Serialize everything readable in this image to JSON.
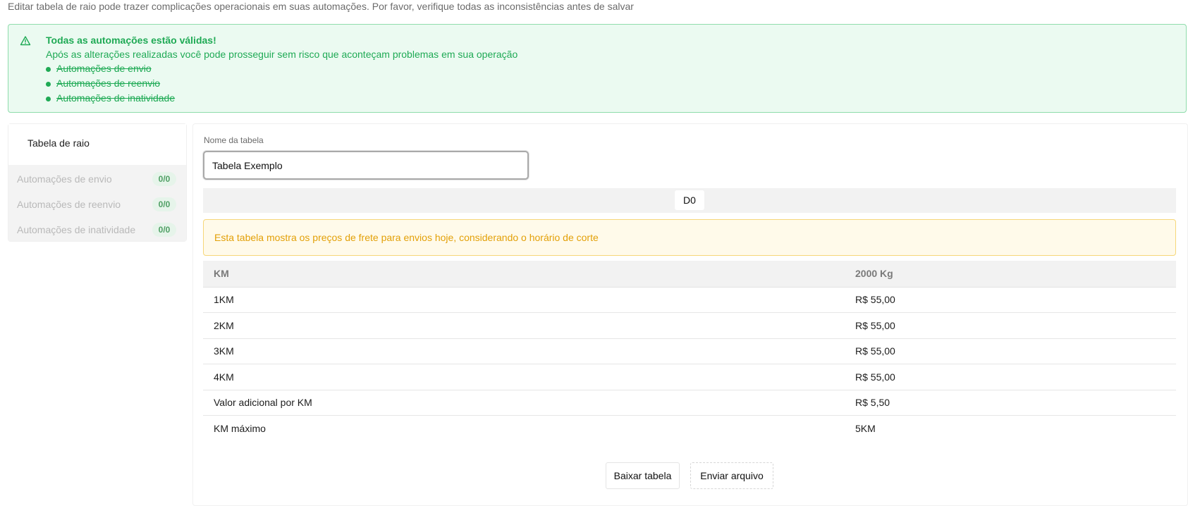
{
  "top_note": "Editar tabela de raio pode trazer complicações operacionais em suas automações. Por favor, verifique todas as inconsistências antes de salvar",
  "success_alert": {
    "icon": "warning-triangle-icon",
    "title": "Todas as automações estão válidas!",
    "description": "Após as alterações realizadas você pode prosseguir sem risco que aconteçam problemas em sua operação",
    "items": [
      "Automações de envio",
      "Automações de reenvio",
      "Automações de inatividade"
    ]
  },
  "sidebar": {
    "header": "Tabela de raio",
    "items": [
      {
        "label": "Automações de envio",
        "badge": "0/0"
      },
      {
        "label": "Automações de reenvio",
        "badge": "0/0"
      },
      {
        "label": "Automações de inatividade",
        "badge": "0/0"
      }
    ]
  },
  "form": {
    "name_label": "Nome da tabela",
    "name_value": "Tabela Exemplo"
  },
  "tabs": {
    "active": "D0"
  },
  "warning_alert": "Esta tabela mostra os preços de frete para envios hoje, considerando o horário de corte",
  "table": {
    "headers": [
      "KM",
      "2000 Kg"
    ],
    "rows": [
      {
        "km": "1KM",
        "price": "R$ 55,00"
      },
      {
        "km": "2KM",
        "price": "R$ 55,00"
      },
      {
        "km": "3KM",
        "price": "R$ 55,00"
      },
      {
        "km": "4KM",
        "price": "R$ 55,00"
      },
      {
        "km": "Valor adicional por KM",
        "price": "R$ 5,50"
      },
      {
        "km": "KM máximo",
        "price": "5KM"
      }
    ]
  },
  "buttons": {
    "download": "Baixar tabela",
    "upload": "Enviar arquivo"
  },
  "colors": {
    "success": "#1faa55",
    "warning": "#e3a008"
  }
}
